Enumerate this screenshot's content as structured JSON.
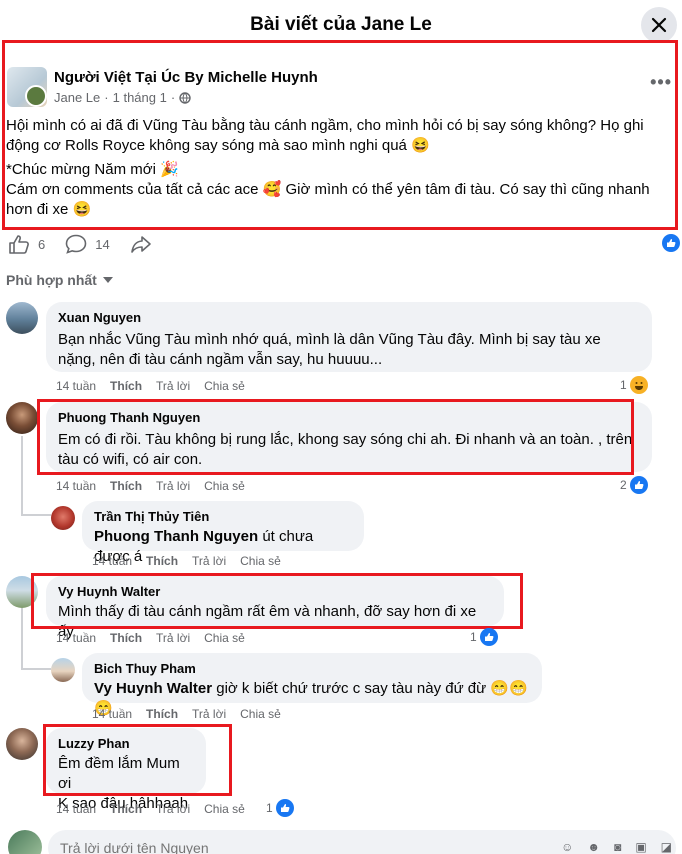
{
  "header": {
    "title": "Bài viết của Jane Le"
  },
  "post": {
    "group": "Người Việt Tại Úc By Michelle Huynh",
    "author": "Jane Le",
    "time": "1 tháng 1",
    "paragraphs": [
      "Hội mình có ai đã đi Vũng Tàu bằng tàu cánh ngầm, cho mình hỏi có bị say sóng không? Họ ghi động cơ Rolls Royce không say sóng mà sao mình nghi quá 😆",
      "*Chúc mừng Năm mới 🎉",
      "Cám ơn comments của tất cả các ace 🥰 Giờ mình có thể yên tâm đi tàu. Có say thì cũng nhanh hơn đi xe 😆"
    ],
    "like_count": "6",
    "comment_count": "14"
  },
  "sort": {
    "label": "Phù hợp nhất"
  },
  "actions": {
    "like": "Thích",
    "reply": "Trả lời",
    "share": "Chia sẻ"
  },
  "comments": [
    {
      "author": "Xuan Nguyen",
      "text": "Bạn nhắc Vũng Tàu mình nhớ quá, mình là dân Vũng Tàu đây. Mình bị say tàu xe nặng, nên đi tàu cánh ngầm vẫn say, hu huuuu...",
      "time": "14 tuần",
      "reactions": "1"
    },
    {
      "author": "Phuong Thanh Nguyen",
      "text": "Em có đi rồi. Tàu không bị rung lắc, khong say sóng chi ah. Đi nhanh và an toàn. , trên tàu có wifi, có air con.",
      "time": "14 tuần",
      "reactions": "2"
    },
    {
      "author": "Trần Thị Thủy Tiên",
      "mention": "Phuong Thanh Nguyen",
      "text": "út chưa được á",
      "time": "14 tuần"
    },
    {
      "author": "Vy Huynh Walter",
      "text": "Mình thấy đi tàu cánh ngầm rất êm và nhanh, đỡ say hơn đi xe ấy",
      "time": "14 tuần",
      "reactions": "1"
    },
    {
      "author": "Bich Thuy Pham",
      "mention": "Vy Huynh Walter",
      "text": "giờ k biết chứ trước c say tàu này đứ đừ 😁😁😁",
      "time": "14 tuần"
    },
    {
      "author": "Luzzy Phan",
      "text_line1": "Êm đềm lắm Mum ơi",
      "text_line2": "K sao đâu hâhhaah",
      "time": "14 tuần",
      "reactions": "1"
    }
  ],
  "reply": {
    "placeholder": "Trả lời dưới tên Nguyen"
  },
  "colors": {
    "accent": "#1877f2",
    "highlight_box": "#e8191f",
    "bubble": "#f0f2f5",
    "muted": "#65676b"
  }
}
